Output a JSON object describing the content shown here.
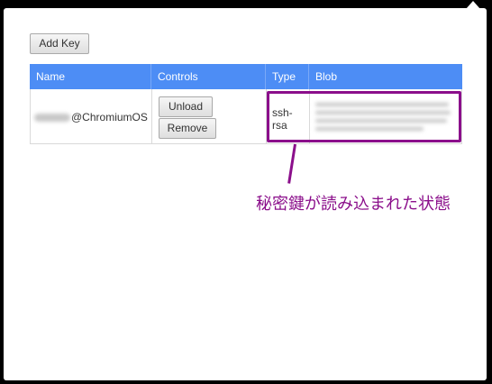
{
  "toolbar": {
    "add_key_label": "Add Key"
  },
  "table": {
    "headers": [
      "Name",
      "Controls",
      "Type",
      "Blob"
    ],
    "rows": [
      {
        "name_suffix": "@ChromiumOS",
        "controls": {
          "unload_label": "Unload",
          "remove_label": "Remove"
        },
        "type_line1": "ssh-",
        "type_line2": "rsa"
      }
    ]
  },
  "annotation": {
    "text": "秘密鍵が読み込まれた状態"
  },
  "colors": {
    "header_bg": "#4d8df5",
    "highlight": "#8b0f8b",
    "background": "#000000"
  }
}
